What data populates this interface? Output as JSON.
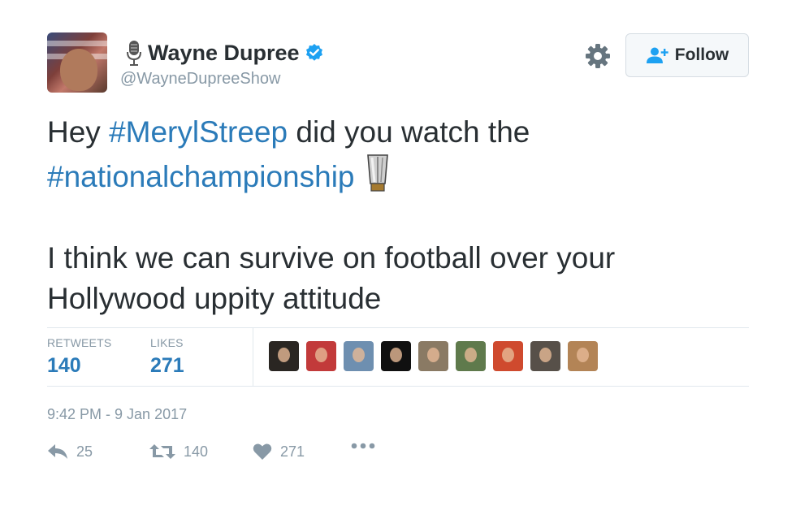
{
  "author": {
    "display_name": "Wayne Dupree",
    "handle": "@WayneDupreeShow",
    "verified": true
  },
  "follow_button": {
    "label": "Follow"
  },
  "tweet": {
    "lines": [
      [
        {
          "text": "Hey ",
          "type": "text"
        },
        {
          "text": "#MerylStreep",
          "type": "hashtag"
        },
        {
          "text": " did you watch the",
          "type": "text"
        }
      ],
      [
        {
          "text": "#nationalchampionship",
          "type": "hashtag"
        }
      ],
      [],
      [
        {
          "text": "I think we can survive on football over your",
          "type": "text"
        }
      ],
      [
        {
          "text": "Hollywood uppity attitude",
          "type": "text"
        }
      ]
    ],
    "emoji": "trophy-icon"
  },
  "stats": {
    "retweets_label": "RETWEETS",
    "retweets": "140",
    "likes_label": "LIKES",
    "likes": "271"
  },
  "likers": [
    {
      "name": "liker-avatar-1",
      "color": "#2a2622"
    },
    {
      "name": "liker-avatar-2",
      "color": "#c23a3a"
    },
    {
      "name": "liker-avatar-3",
      "color": "#6e8fb0"
    },
    {
      "name": "liker-avatar-4",
      "color": "#101010"
    },
    {
      "name": "liker-avatar-5",
      "color": "#8a7a64"
    },
    {
      "name": "liker-avatar-6",
      "color": "#5f7a4c"
    },
    {
      "name": "liker-avatar-7",
      "color": "#cf4a2e"
    },
    {
      "name": "liker-avatar-8",
      "color": "#575049"
    },
    {
      "name": "liker-avatar-9",
      "color": "#b38456"
    }
  ],
  "timestamp": "9:42 PM - 9 Jan 2017",
  "actions": {
    "reply_count": "25",
    "retweet_count": "140",
    "like_count": "271"
  },
  "colors": {
    "link": "#2b7bb9",
    "verified": "#1da1f2",
    "muted": "#8899a6",
    "text": "#292f33"
  }
}
